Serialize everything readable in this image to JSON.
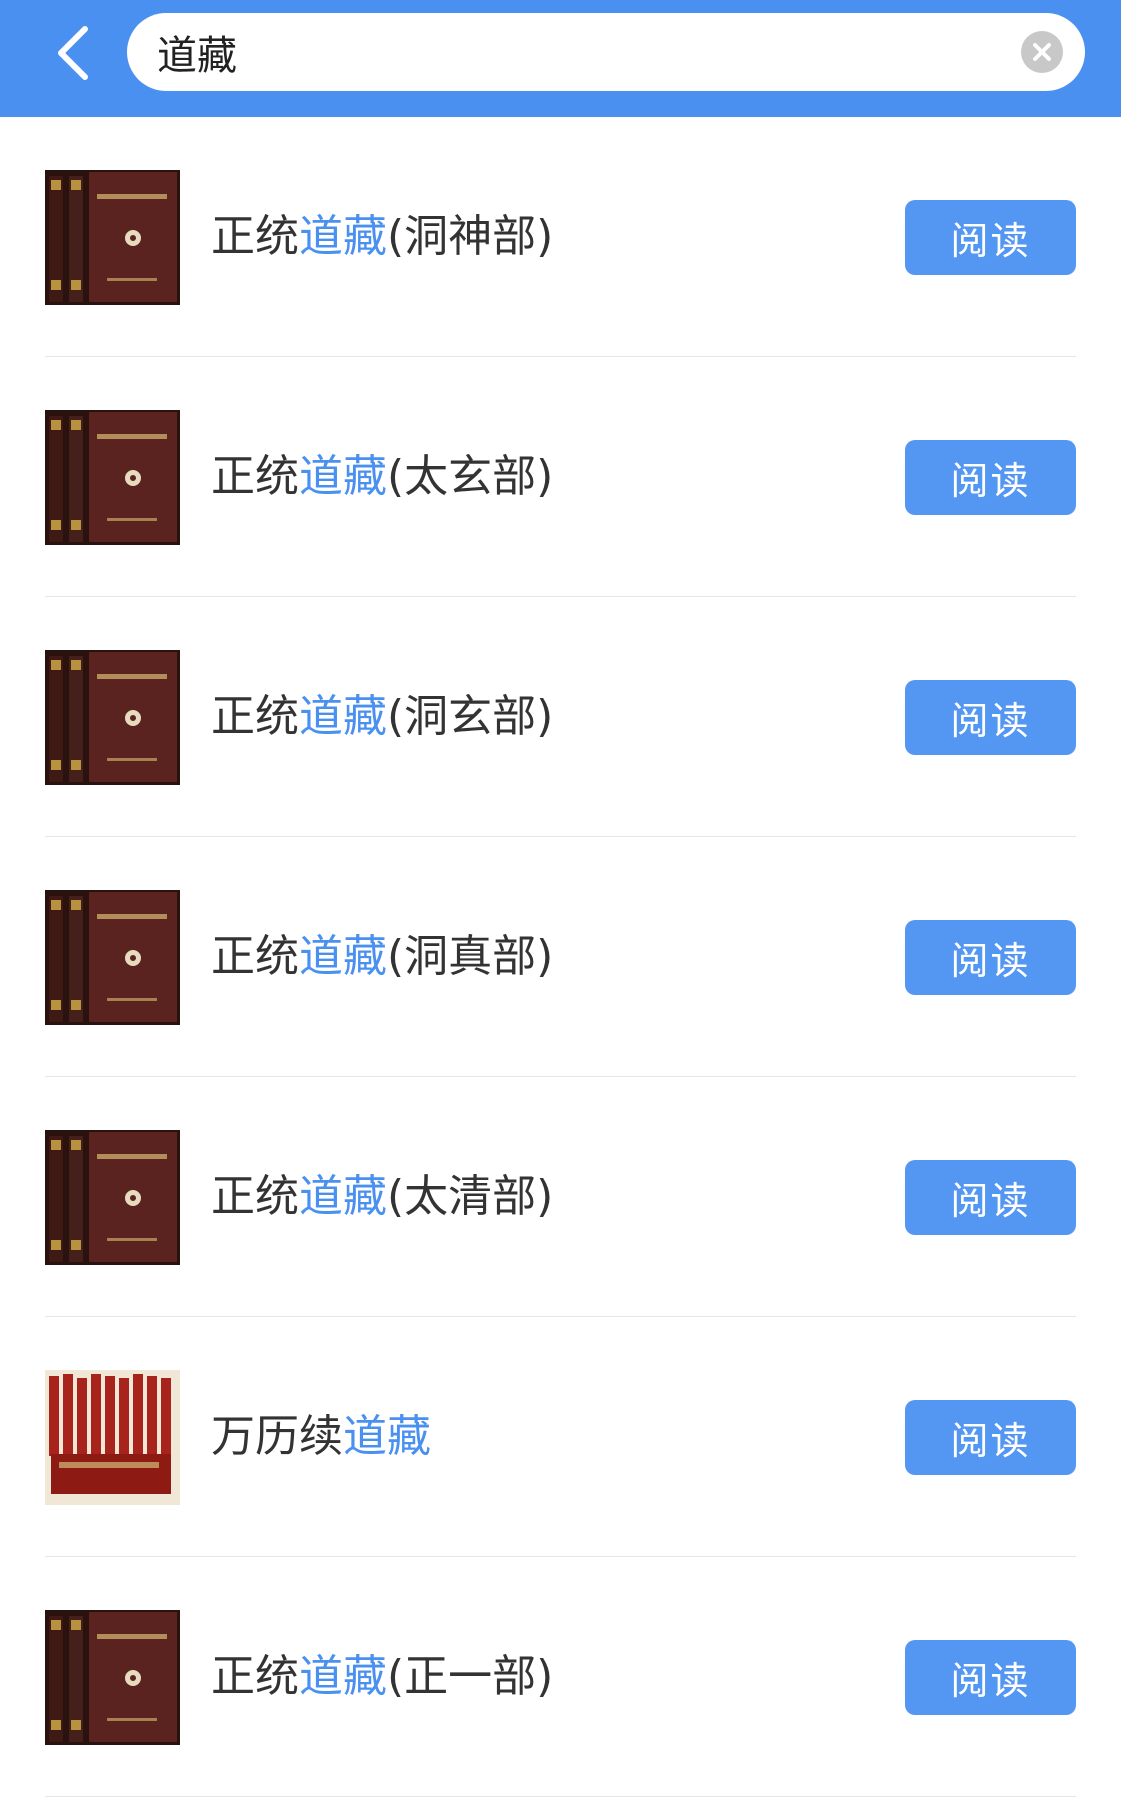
{
  "header": {
    "search_value": "道藏",
    "back_icon": "chevron-left-icon",
    "clear_icon": "close-circle-icon"
  },
  "colors": {
    "bar": "#4a90f0",
    "highlight": "#4a90f0",
    "button": "#5497f2"
  },
  "results": [
    {
      "prefix": "正统",
      "highlight": "道藏",
      "suffix": "(洞神部)",
      "cover": "zhengtong",
      "button": "阅读"
    },
    {
      "prefix": "正统",
      "highlight": "道藏",
      "suffix": "(太玄部)",
      "cover": "zhengtong",
      "button": "阅读"
    },
    {
      "prefix": "正统",
      "highlight": "道藏",
      "suffix": "(洞玄部)",
      "cover": "zhengtong",
      "button": "阅读"
    },
    {
      "prefix": "正统",
      "highlight": "道藏",
      "suffix": "(洞真部)",
      "cover": "zhengtong",
      "button": "阅读"
    },
    {
      "prefix": "正统",
      "highlight": "道藏",
      "suffix": "(太清部)",
      "cover": "zhengtong",
      "button": "阅读"
    },
    {
      "prefix": "万历续",
      "highlight": "道藏",
      "suffix": "",
      "cover": "wanli",
      "button": "阅读"
    },
    {
      "prefix": "正统",
      "highlight": "道藏",
      "suffix": "(正一部)",
      "cover": "zhengtong",
      "button": "阅读"
    }
  ]
}
